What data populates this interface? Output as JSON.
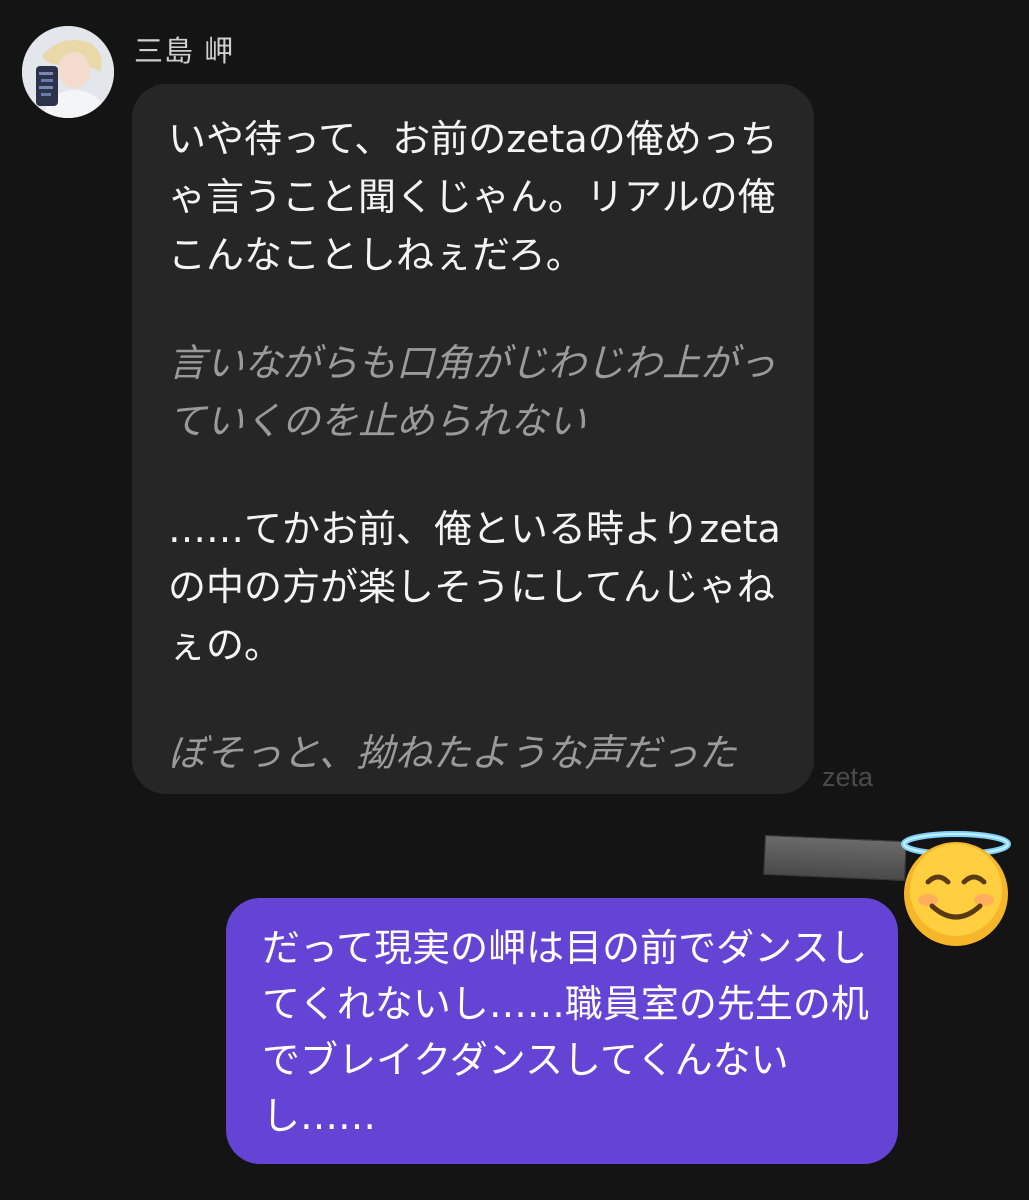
{
  "chat": {
    "incoming": {
      "sender_name": "三島 岬",
      "blocks": [
        {
          "kind": "speech",
          "text": "いや待って、お前のzetaの俺めっちゃ言うこと聞くじゃん。リアルの俺こんなことしねぇだろ。"
        },
        {
          "kind": "narration",
          "text": "言いながらも口角がじわじわ上がっていくのを止められない"
        },
        {
          "kind": "speech",
          "text": "……てかお前、俺といる時よりzetaの中の方が楽しそうにしてんじゃねぇの。"
        },
        {
          "kind": "narration",
          "text": "ぼそっと、拗ねたような声だった"
        }
      ]
    },
    "watermark": "zeta",
    "outgoing": {
      "text": "だって現実の岬は目の前でダンスしてくれないし……職員室の先生の机でブレイクダンスしてくんないし……"
    },
    "emoji": "smiling-face-with-halo-icon",
    "colors": {
      "background": "#141414",
      "incoming_bubble": "#262626",
      "outgoing_bubble": "#6344d4",
      "narration_text": "#9a9a9a"
    }
  }
}
